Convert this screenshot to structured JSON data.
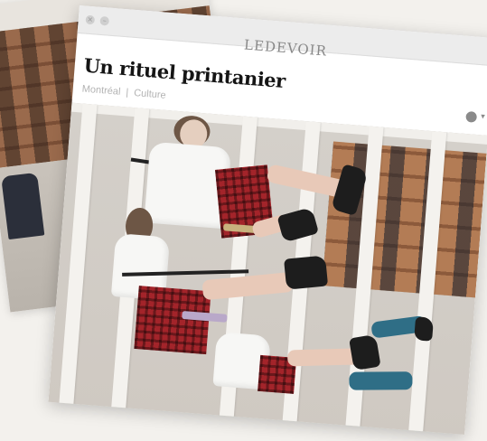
{
  "browser": {
    "masthead": "LEDEVOIR"
  },
  "article": {
    "headline": "Un rituel printanier",
    "byline": {
      "author": "Montréal",
      "separator": "|",
      "section": "Culture"
    }
  },
  "icons": {
    "window_controls": [
      "close-dot-icon",
      "minimize-dot-icon"
    ],
    "share": "share-icon",
    "dropdown": "chevron-down-icon"
  },
  "colors": {
    "headline": "#151515",
    "masthead": "#888888",
    "byline": "#b3b3b3",
    "kilt_red": "#a3242a",
    "background": "#f3f1ed"
  }
}
